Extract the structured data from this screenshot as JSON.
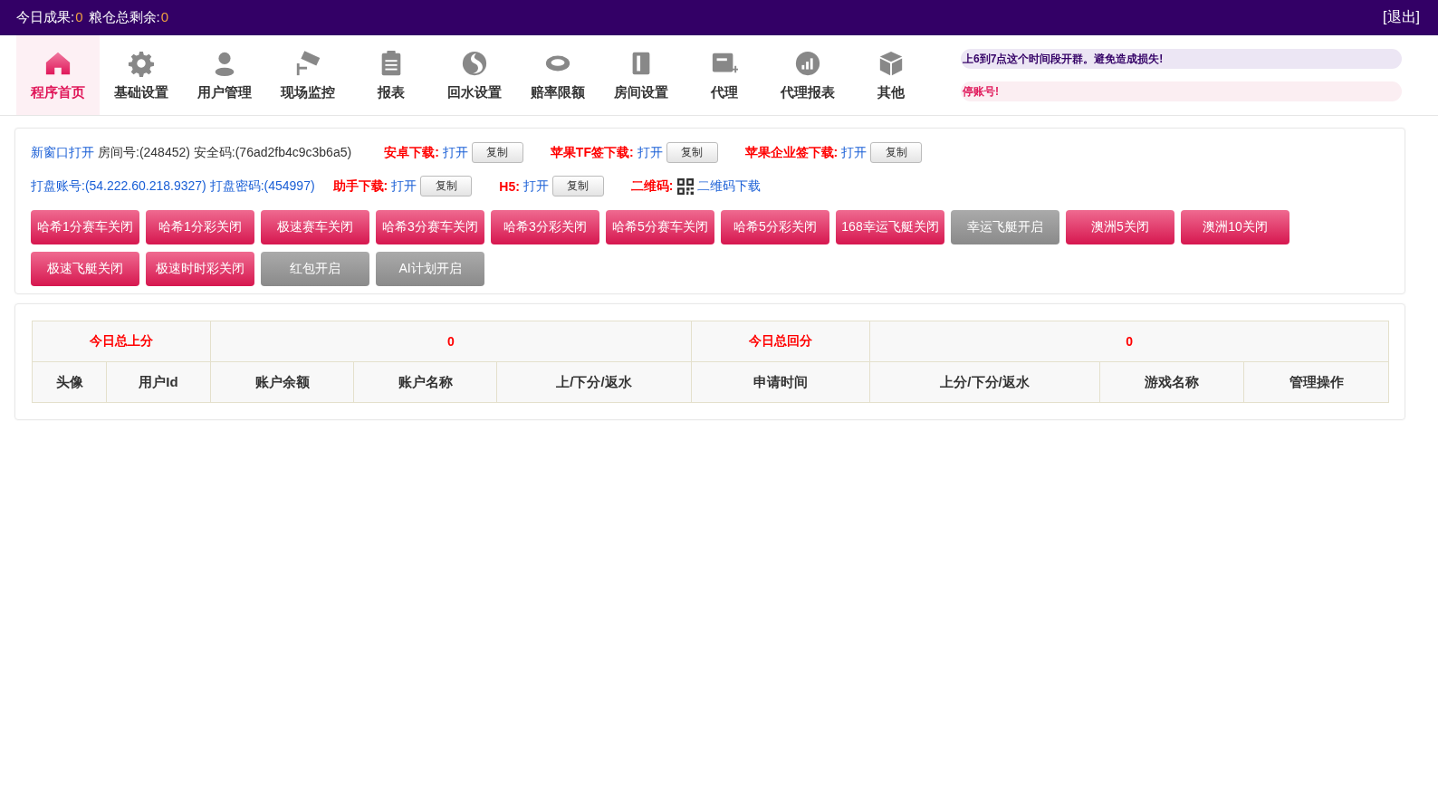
{
  "top_bar": {
    "stats": [
      {
        "label": "今日成果:",
        "value": "0"
      },
      {
        "label": "粮仓总剩余:",
        "value": "0"
      }
    ],
    "logout": "[退出]"
  },
  "nav": [
    {
      "label": "程序首页",
      "selected": true
    },
    {
      "label": "基础设置",
      "selected": false
    },
    {
      "label": "用户管理",
      "selected": false
    },
    {
      "label": "现场监控",
      "selected": false
    },
    {
      "label": "报表",
      "selected": false
    },
    {
      "label": "回水设置",
      "selected": false
    },
    {
      "label": "赔率限额",
      "selected": false
    },
    {
      "label": "房间设置",
      "selected": false
    },
    {
      "label": "代理",
      "selected": false
    },
    {
      "label": "代理报表",
      "selected": false
    },
    {
      "label": "其他",
      "selected": false
    }
  ],
  "notices": [
    {
      "kind": "info",
      "text": "上6到7点这个时间段开群。避免造成损失!"
    },
    {
      "kind": "warning",
      "text": "停账号!"
    }
  ],
  "info": {
    "open_link": "新窗口打开",
    "room": "房间号:(248452) 安全码:(76ad2fb4c9c3b6a5)",
    "account": "打盘账号:(54.222.60.218.9327) 打盘密码:(454997)"
  },
  "downloads": [
    [
      {
        "kind": "copy",
        "label": "安卓下载:",
        "link": "打开",
        "copy": "复制"
      },
      {
        "kind": "copy",
        "label": "苹果TF签下载:",
        "link": "打开",
        "copy": "复制"
      },
      {
        "kind": "copy",
        "label": "苹果企业签下载:",
        "link": "打开",
        "copy": "复制"
      }
    ],
    [
      {
        "kind": "copy",
        "label": "助手下载:",
        "link": "打开",
        "copy": "复制"
      },
      {
        "kind": "copy",
        "label": "H5:",
        "link": "打开",
        "copy": "复制"
      },
      {
        "kind": "qr",
        "label": "二维码:",
        "link": "二维码下载"
      }
    ]
  ],
  "toggles": [
    [
      {
        "label": "哈希1分赛车关闭",
        "on": true
      },
      {
        "label": "哈希1分彩关闭",
        "on": true
      },
      {
        "label": "极速赛车关闭",
        "on": true
      },
      {
        "label": "哈希3分赛车关闭",
        "on": true
      },
      {
        "label": "哈希3分彩关闭",
        "on": true
      },
      {
        "label": "哈希5分赛车关闭",
        "on": true
      },
      {
        "label": "哈希5分彩关闭",
        "on": true
      },
      {
        "label": "168幸运飞艇关闭",
        "on": true
      },
      {
        "label": "幸运飞艇开启",
        "on": false
      },
      {
        "label": "澳洲5关闭",
        "on": true
      },
      {
        "label": "澳洲10关闭",
        "on": true
      }
    ],
    [
      {
        "label": "极速飞艇关闭",
        "on": true
      },
      {
        "label": "极速时时彩关闭",
        "on": true
      },
      {
        "label": "红包开启",
        "on": false
      },
      {
        "label": "AI计划开启",
        "on": false
      }
    ]
  ],
  "table": {
    "summary": [
      "今日总上分",
      "0",
      "今日总回分",
      "0"
    ],
    "columns": [
      "头像",
      "用户Id",
      "账户余额",
      "账户名称",
      "上/下分/返水",
      "申请时间",
      "上分/下分/返水",
      "游戏名称",
      "管理操作"
    ]
  }
}
